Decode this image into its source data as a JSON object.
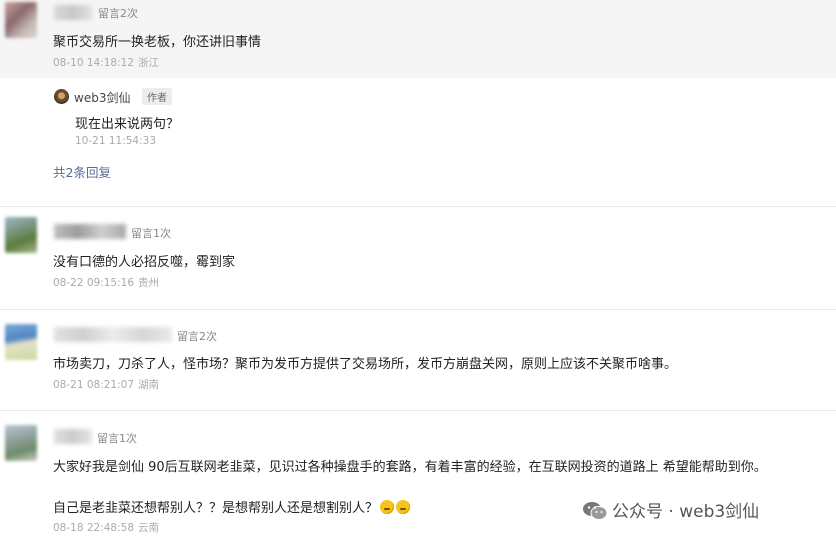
{
  "comments": [
    {
      "count": "留言2次",
      "content": "聚币交易所一换老板，你还讲旧事情",
      "time": "08-10 14:18:12",
      "location": "浙江",
      "reply": {
        "name": "web3剑仙",
        "badge": "作者",
        "content": "现在出来说两句？",
        "time": "10-21 11:54:33"
      },
      "more_replies": "共2条回复"
    },
    {
      "count": "留言1次",
      "content": "没有口德的人必招反噬，霉到家",
      "time": "08-22 09:15:16",
      "location": "贵州"
    },
    {
      "count": "留言2次",
      "content": "市场卖刀，刀杀了人，怪市场？聚币为发币方提供了交易场所，发币方崩盘关网，原则上应该不关聚币啥事。",
      "time": "08-21 08:21:07",
      "location": "湖南"
    },
    {
      "count": "留言1次",
      "content": "大家好我是剑仙  90后互联网老韭菜，见识过各种操盘手的套路，有着丰富的经验，在互联网投资的道路上 希望能帮助到你。",
      "content2": "自己是老韭菜还想帮别人？？是想帮别人还是想割别人？",
      "time": "08-18 22:48:58",
      "location": "云南"
    }
  ],
  "watermark": "公众号 · web3剑仙",
  "colors": {
    "link": "#576b95",
    "meta": "#aaaaaa",
    "highlight_bg": "#f5f5f5"
  }
}
